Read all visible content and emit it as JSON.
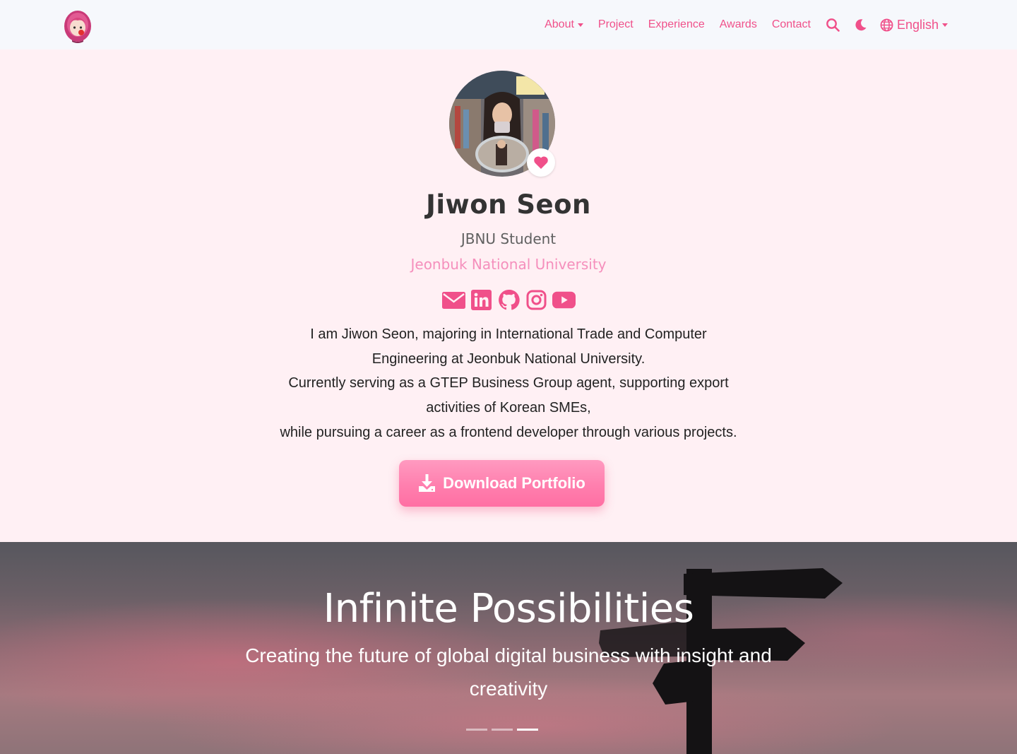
{
  "nav": {
    "about": "About",
    "project": "Project",
    "experience": "Experience",
    "awards": "Awards",
    "contact": "Contact",
    "language": "English",
    "icons": [
      "search-icon",
      "moon-icon",
      "globe-icon"
    ]
  },
  "profile": {
    "name": "Jiwon Seon",
    "role": "JBNU Student",
    "university": "Jeonbuk National University",
    "socials": [
      "email-icon",
      "linkedin-icon",
      "github-icon",
      "instagram-icon",
      "youtube-icon"
    ],
    "bio": [
      "I am Jiwon Seon, majoring in International Trade and Computer",
      "Engineering at Jeonbuk National University.",
      "Currently serving as a GTEP Business Group agent, supporting export",
      "activities of Korean SMEs,",
      "while pursuing a career as a frontend developer through various projects."
    ],
    "download_label": "Download Portfolio"
  },
  "hero": {
    "title": "Infinite Possibilities",
    "subtitle_line1": "Creating the future of global digital business with insight and",
    "subtitle_line2": "creativity",
    "slides": 3,
    "active_slide": 3
  },
  "colors": {
    "accent": "#f0508a",
    "university": "#f58fbc",
    "page_bg": "#fff0f4",
    "nav_bg": "#f6f8fc"
  }
}
